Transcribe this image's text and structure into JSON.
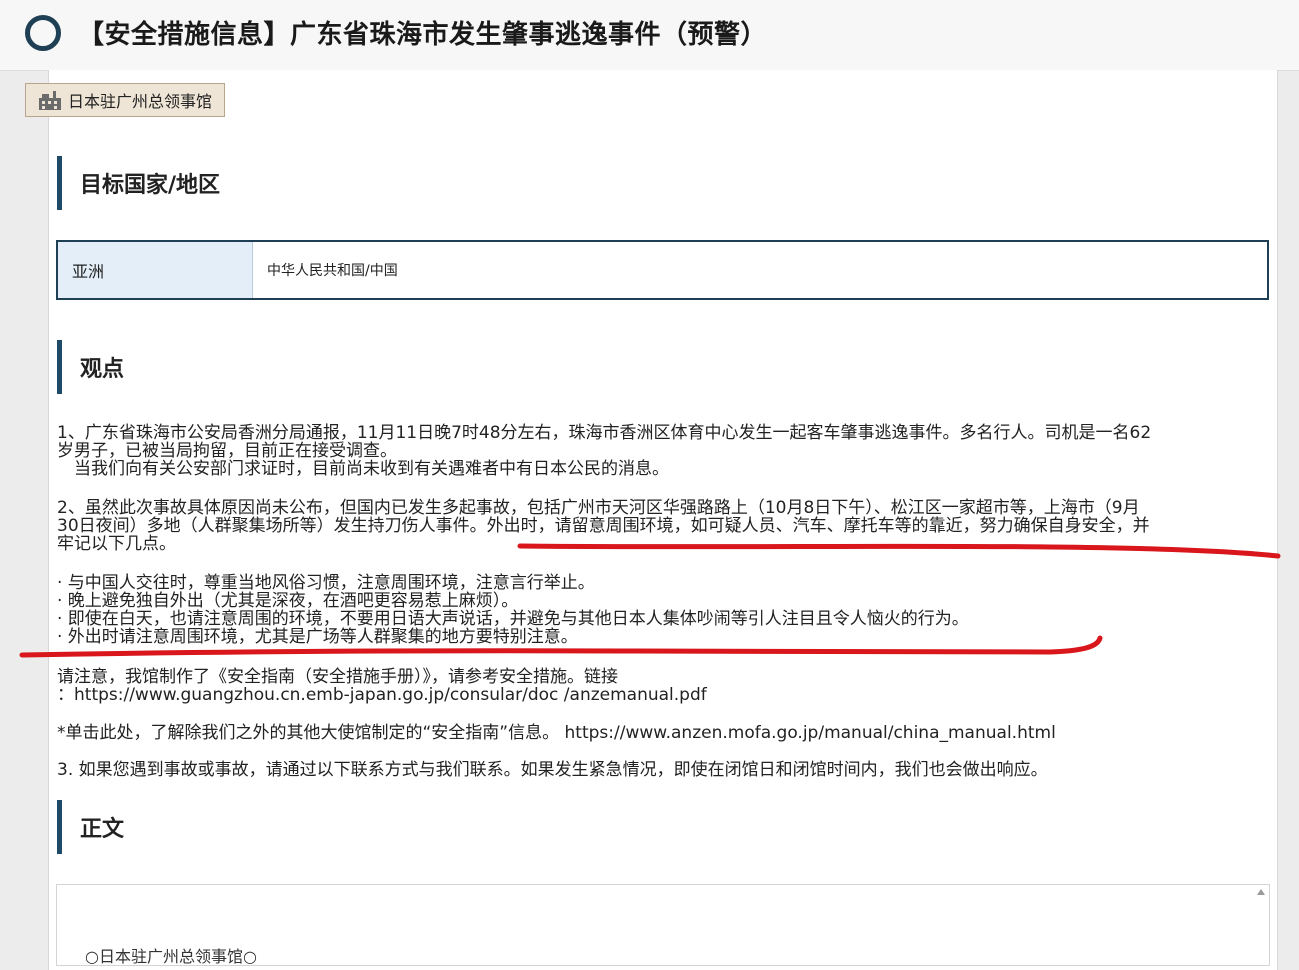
{
  "header": {
    "title": "【安全措施信息】广东省珠海市发生肇事逃逸事件（预警）",
    "icon": "circle-ring-icon"
  },
  "issuer": {
    "label": "日本驻广州总领事馆",
    "icon": "building-icon"
  },
  "sections": {
    "target": "目标国家/地区",
    "viewpoint": "观点",
    "body": "正文"
  },
  "region": {
    "area": "亚洲",
    "country": "中华人民共和国/中国"
  },
  "content": {
    "p1_line1": "1、广东省珠海市公安局香洲分局通报，11月11日晚7时48分左右，珠海市香洲区体育中心发生一起客车肇事逃逸事件。多名行人。司机是一名62",
    "p1_line2": "岁男子，已被当局拘留，目前正在接受调查。",
    "p1_line3": "　当我们向有关公安部门求证时，目前尚未收到有关遇难者中有日本公民的消息。",
    "p2_line1": "2、虽然此次事故具体原因尚未公布，但国内已发生多起事故，包括广州市天河区华强路路上（10月8日下午）、松江区一家超市等，上海市（9月",
    "p2_line2": "30日夜间）多地（人群聚集场所等）发生持刀伤人事件。外出时，请留意周围环境，如可疑人员、汽车、摩托车等的靠近，努力确保自身安全，并",
    "p2_line3": "牢记以下几点。",
    "bullet1": "· 与中国人交往时，尊重当地风俗习惯，注意周围环境，注意言行举止。",
    "bullet2": "· 晚上避免独自外出（尤其是深夜，在酒吧更容易惹上麻烦）。",
    "bullet3": "· 即使在白天，也请注意周围的环境，不要用日语大声说话，并避免与其他日本人集体吵闹等引人注目且令人恼火的行为。",
    "bullet4": "· 外出时请注意周围环境，尤其是广场等人群聚集的地方要特别注意。",
    "manual_line1": "请注意，我馆制作了《安全指南（安全措施手册）》，请参考安全措施。链接",
    "manual_line2": "：https://www.guangzhou.cn.emb-japan.go.jp/consular/doc /anzemanual.pdf",
    "other_manual": "*单击此处，了解除我们之外的其他大使馆制定的“安全指南”信息。 https://www.anzen.mofa.go.jp/manual/china_manual.html",
    "p3": "3. 如果您遇到事故或事故，请通过以下联系方式与我们联系。如果发生紧急情况，即使在闭馆日和闭馆时间内，我们也会做出响应。"
  },
  "body_preview": "○日本驻广州总领事馆○",
  "colors": {
    "heading_bar": "#1f4a68",
    "annotation": "#d8161b",
    "region_cell": "#e3eef8"
  }
}
